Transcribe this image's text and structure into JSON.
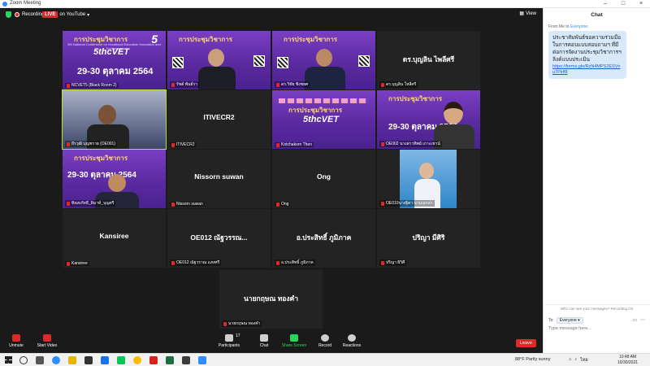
{
  "window": {
    "title": "Zoom Meeting",
    "controls": [
      "–",
      "□",
      "×"
    ]
  },
  "top": {
    "recording": "Recording",
    "live_badge": "LIVE",
    "live_on": "on YouTube",
    "view": "View"
  },
  "tiles": [
    {
      "name": "NCVET5 (Black Room 2)",
      "center": ""
    },
    {
      "name": "รัชต์ พันธ์รา",
      "center": ""
    },
    {
      "name": "ดร.วิชัย  ชิงชยศ",
      "center": ""
    },
    {
      "name": "ดร.บุญลิน  ใหลีศรี",
      "center": "ดร.บุญลิน  ไพลีศรี"
    },
    {
      "name": "ธีรวุฒิ  บุญชราย (OE001)",
      "center": ""
    },
    {
      "name": "ITIVECR2",
      "center": "ITIVECR2"
    },
    {
      "name": "Kotchakorn Then",
      "center": ""
    },
    {
      "name": "OE002 นางสาวทิพย์ เกาะเชาน์",
      "center": ""
    },
    {
      "name": "ทิณทภัทธี_ดิมาท์_บุญศรี",
      "center": ""
    },
    {
      "name": "Nissorn suwan",
      "center": "Nissorn suwan"
    },
    {
      "name": "Ong",
      "center": "Ong"
    },
    {
      "name": "OE010นางฐิตา นามเอกล่า",
      "center": ""
    },
    {
      "name": "Kansiree",
      "center": "Kansiree"
    },
    {
      "name": "OE012 ณัฐวราณ  แสงศรี",
      "center": "OE012 ณัฐวรรณ..."
    },
    {
      "name": "อ.ประสิทธิ์ ภูมิภาค",
      "center": "อ.ประสิทธิ์ ภูมิภาค"
    },
    {
      "name": "ปริญา  ผิวิศี",
      "center": "ปริญา  มีศิริ"
    },
    {
      "name": "นายกฤษณ ทองคำ",
      "center": "นายกฤษณ ทองคำ"
    }
  ],
  "poster": {
    "title": "การประชุมวิชาการ",
    "edition": "ครั้งที่ 5",
    "logo": "5thcVET",
    "date": "29-30 ตุลาคม 2564",
    "subtitle": "5th National Conference on Vocational Education Innovation and Technology"
  },
  "chat": {
    "header": "Chat",
    "from": "From Me to",
    "to_whom": "Everyone",
    "message": "ประชาสัมพันธ์ขอความร่วมมือในการตอบแบบสอบถามฯ ที่มีต่อการจัดงานประชุมวิชาการฯ ลิงค์แบบประเมิน",
    "link": "https://forms.gle/RzN4MPS2ESVnu7Pkff8",
    "notice": "Who can see your messages? Recording On",
    "to_label": "To:",
    "to_select": "Everyone",
    "placeholder": "Type message here..."
  },
  "toolbar": {
    "unmute": "Unmute",
    "start_video": "Start Video",
    "participants": "Participants",
    "participants_count": "17",
    "chat": "Chat",
    "share": "Share Screen",
    "record": "Record",
    "reactions": "Reactions",
    "leave": "Leave"
  },
  "taskbar": {
    "weather": "88°F  Partly sunny",
    "lang": "ไทย",
    "time": "10:48 AM",
    "date": "10/30/2021"
  },
  "colors": {
    "accent": "#2d8cff",
    "danger": "#e02828",
    "success": "#23d959",
    "poster": "#6a33b4",
    "active_speaker": "#b8e23a"
  }
}
